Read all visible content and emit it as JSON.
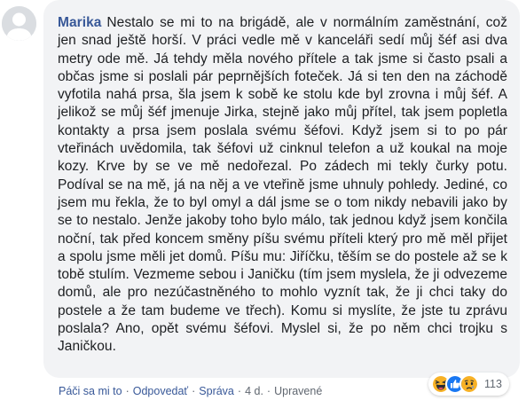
{
  "comment": {
    "author": "Marika",
    "text": "Nestalo se mi to na brigádě, ale v normálním zaměstnání, což jen snad ještě horší. V práci vedle mě v kanceláři sedí můj šéf asi dva metry ode mě. Já tehdy měla nového přítele a tak jsme si často psali a občas jsme si poslali pár peprnějších foteček. Já si ten den na záchodě vyfotila nahá prsa, šla jsem k sobě ke stolu kde byl zrovna i můj šéf. A jelikož se můj šéf jmenuje Jirka, stejně jako můj přítel, tak jsem popletla kontakty a prsa jsem poslala svému šéfovi. Když jsem si to po pár vteřinách uvědomila, tak šéfovi už cinknul telefon a už koukal na moje kozy. Krve by se ve mě nedořezal. Po zádech mi tekly čurky potu. Podíval se na mě, já na něj a ve vteřině jsme uhnuly pohledy. Jediné, co jsem mu řekla, že to byl omyl a dál jsme se o tom nikdy nebavili jako by se to nestalo. Jenže jakoby toho bylo málo, tak jednou když jsem končila noční, tak před koncem směny píšu svému příteli který pro mě měl přijet a spolu jsme měli jet domů. Píšu mu: Jiříčku, těším se do postele až se k tobě stulím. Vezmeme sebou i Janičku (tím jsem myslela, že ji odvezeme domů, ale pro nezúčastněného to mohlo vyznít tak, že ji chci taky do postele a že tam budeme ve třech). Komu si myslíte, že jste tu zprávu poslala? Ano, opět svému šéfovi. Myslel si, že po něm chci trojku s Janičkou."
  },
  "actions": {
    "like": "Páči sa mi to",
    "reply": "Odpovedať",
    "message": "Správa",
    "time": "4 d.",
    "edited": "Upravené",
    "separator": "·"
  },
  "reactions": {
    "icons": [
      "haha-icon",
      "like-icon",
      "sad-icon"
    ],
    "count": "113"
  },
  "colors": {
    "author": "#385898",
    "bubble": "#f2f3f5",
    "text": "#1c1e21",
    "meta": "#606770",
    "like_blue": "#1877f2",
    "emoji_yellow": "#f7b125"
  }
}
